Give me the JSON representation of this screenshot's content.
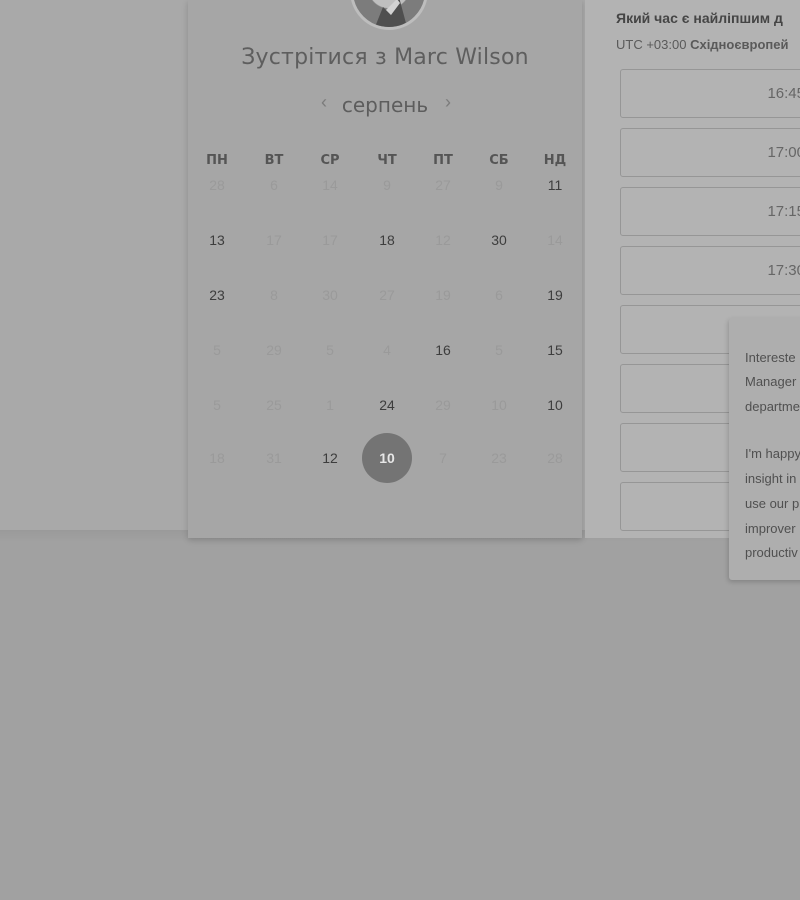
{
  "booking": {
    "title": "Зустрітися з Marc Wilson",
    "month": "серпень",
    "prev_icon": "chevron-left-icon",
    "next_icon": "chevron-right-icon",
    "weekdays": [
      "ПН",
      "ВТ",
      "СР",
      "ЧТ",
      "ПТ",
      "СБ",
      "НД"
    ],
    "weeks": [
      [
        {
          "d": "28",
          "on": false
        },
        {
          "d": "6",
          "on": false
        },
        {
          "d": "14",
          "on": false
        },
        {
          "d": "9",
          "on": false
        },
        {
          "d": "27",
          "on": false
        },
        {
          "d": "9",
          "on": false
        },
        {
          "d": "11",
          "on": true
        }
      ],
      [
        {
          "d": "13",
          "on": true
        },
        {
          "d": "17",
          "on": false
        },
        {
          "d": "17",
          "on": false
        },
        {
          "d": "18",
          "on": true
        },
        {
          "d": "12",
          "on": false
        },
        {
          "d": "30",
          "on": true
        },
        {
          "d": "14",
          "on": false
        }
      ],
      [
        {
          "d": "23",
          "on": true
        },
        {
          "d": "8",
          "on": false
        },
        {
          "d": "30",
          "on": false
        },
        {
          "d": "27",
          "on": false
        },
        {
          "d": "19",
          "on": false
        },
        {
          "d": "6",
          "on": false
        },
        {
          "d": "19",
          "on": true
        }
      ],
      [
        {
          "d": "5",
          "on": false
        },
        {
          "d": "29",
          "on": false
        },
        {
          "d": "5",
          "on": false
        },
        {
          "d": "4",
          "on": false
        },
        {
          "d": "16",
          "on": true
        },
        {
          "d": "5",
          "on": false
        },
        {
          "d": "15",
          "on": true
        }
      ],
      [
        {
          "d": "5",
          "on": false
        },
        {
          "d": "25",
          "on": false
        },
        {
          "d": "1",
          "on": false
        },
        {
          "d": "24",
          "on": true
        },
        {
          "d": "29",
          "on": false
        },
        {
          "d": "10",
          "on": false
        },
        {
          "d": "10",
          "on": true
        }
      ],
      [
        {
          "d": "18",
          "on": false
        },
        {
          "d": "31",
          "on": false
        },
        {
          "d": "12",
          "on": true
        },
        {
          "d": "10",
          "on": true,
          "selected": true
        },
        {
          "d": "7",
          "on": false
        },
        {
          "d": "23",
          "on": false
        },
        {
          "d": "28",
          "on": false
        }
      ]
    ]
  },
  "times": {
    "question": "Який час є найліпшим д",
    "timezone_offset": "UTC +03:00",
    "timezone_name": "Східноєвропей",
    "slots": [
      "16:45",
      "17:00",
      "17:15",
      "17:30",
      "",
      "",
      "",
      ""
    ]
  },
  "note": {
    "lines": [
      "Intereste",
      "Manager",
      "departme",
      "",
      "I'm happy",
      "insight in",
      "use our p",
      "improver",
      "productiv"
    ]
  },
  "colors": {
    "selected_day": "#747474",
    "overlay_gray": "#a1a1a1"
  }
}
